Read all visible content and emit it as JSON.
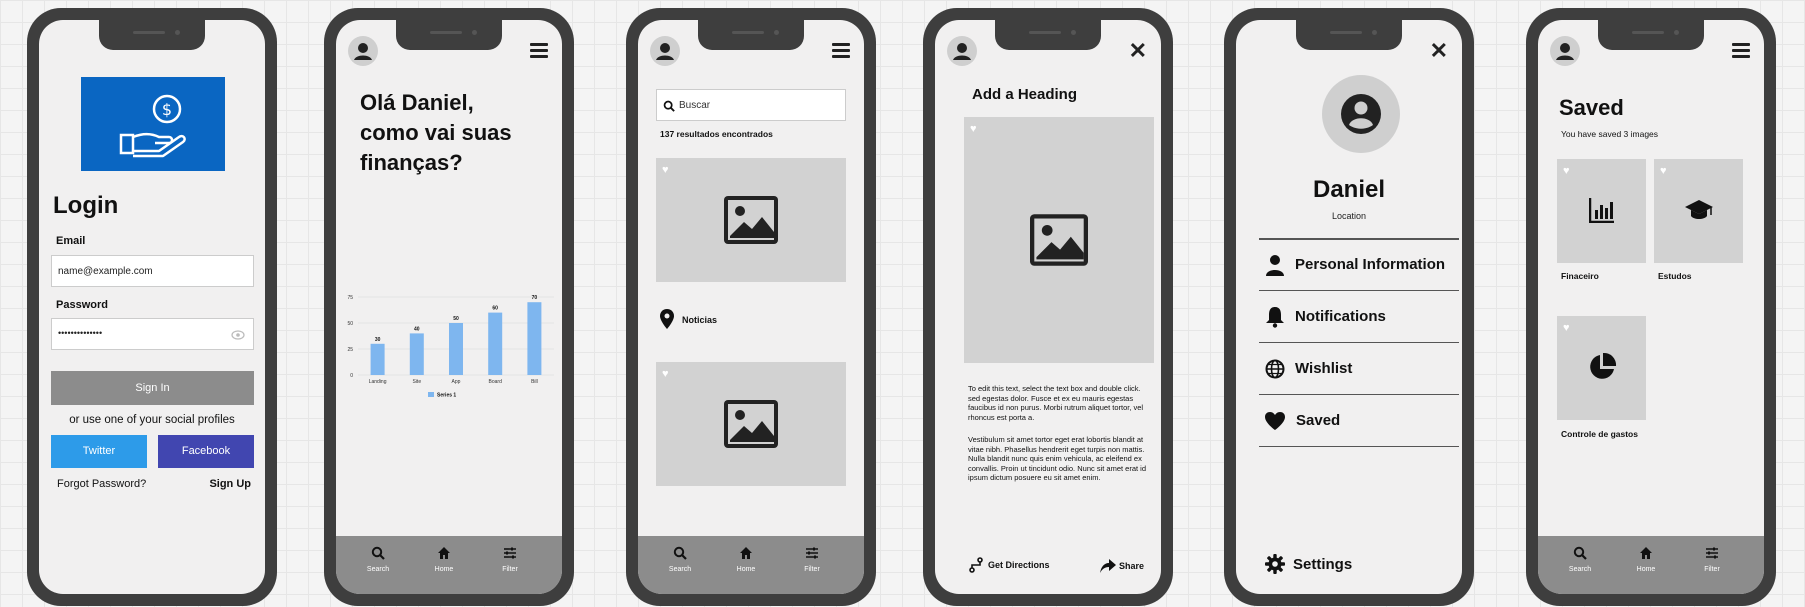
{
  "login": {
    "title": "Login",
    "email_label": "Email",
    "email_value": "name@example.com",
    "password_label": "Password",
    "password_value": "••••••••••••••",
    "sign_in": "Sign In",
    "social_text": "or use one of your social profiles",
    "twitter": "Twitter",
    "facebook": "Facebook",
    "forgot": "Forgot Password?",
    "signup": "Sign Up"
  },
  "dashboard": {
    "greeting_1": "Olá Daniel,",
    "greeting_2": "como vai suas",
    "greeting_3": "finanças?",
    "nav": [
      {
        "label": "Search",
        "icon": "search-icon"
      },
      {
        "label": "Home",
        "icon": "home-icon"
      },
      {
        "label": "Filter",
        "icon": "filter-icon"
      }
    ]
  },
  "chart_data": {
    "type": "bar",
    "categories": [
      "Landing",
      "Site",
      "App",
      "Board",
      "Bill"
    ],
    "series": [
      {
        "name": "Series 1",
        "values": [
          30,
          40,
          50,
          60,
          70
        ]
      }
    ],
    "yticks": [
      "0",
      "25",
      "50",
      "75"
    ],
    "ylim": [
      0,
      75
    ],
    "legend": "bottom",
    "grid": true,
    "bar_color": "#7eb6ef"
  },
  "search": {
    "placeholder": "Buscar",
    "results": "137 resultados encontrados",
    "location_label": "Noticias",
    "nav": [
      {
        "label": "Search"
      },
      {
        "label": "Home"
      },
      {
        "label": "Filter"
      }
    ]
  },
  "detail": {
    "heading": "Add a Heading",
    "para1": "To edit this text, select the text box and double click. sed egestas dolor. Fusce et ex eu mauris egestas faucibus id non purus. Morbi rutrum aliquet tortor, vel rhoncus est porta a.",
    "para2": "Vestibulum sit amet tortor eget erat lobortis blandit at vitae nibh. Phasellus hendrerit eget turpis non mattis. Nulla blandit nunc quis enim vehicula, ac eleifend ex convallis. Proin ut tincidunt odio. Nunc sit amet erat id ipsum dictum posuere eu sit amet enim.",
    "directions": "Get Directions",
    "share": "Share"
  },
  "profile": {
    "name": "Daniel",
    "location": "Location",
    "items": [
      {
        "label": "Personal Information",
        "icon": "person-icon"
      },
      {
        "label": "Notifications",
        "icon": "bell-icon"
      },
      {
        "label": "Wishlist",
        "icon": "globe-icon"
      },
      {
        "label": "Saved",
        "icon": "heart-icon"
      }
    ],
    "settings": "Settings"
  },
  "saved": {
    "title": "Saved",
    "subtitle": "You have saved 3 images",
    "items": [
      {
        "label": "Finaceiro",
        "icon": "bar-chart-icon"
      },
      {
        "label": "Estudos",
        "icon": "graduation-cap-icon"
      },
      {
        "label": "Controle de gastos",
        "icon": "pie-chart-icon"
      }
    ],
    "nav": [
      {
        "label": "Search"
      },
      {
        "label": "Home"
      },
      {
        "label": "Filter"
      }
    ]
  },
  "colors": {
    "brand": "#0a66c2",
    "twitter": "#2d9be9",
    "facebook": "#4146b0",
    "frame": "#3e3e3e",
    "placeholder": "#d2d2d2"
  }
}
